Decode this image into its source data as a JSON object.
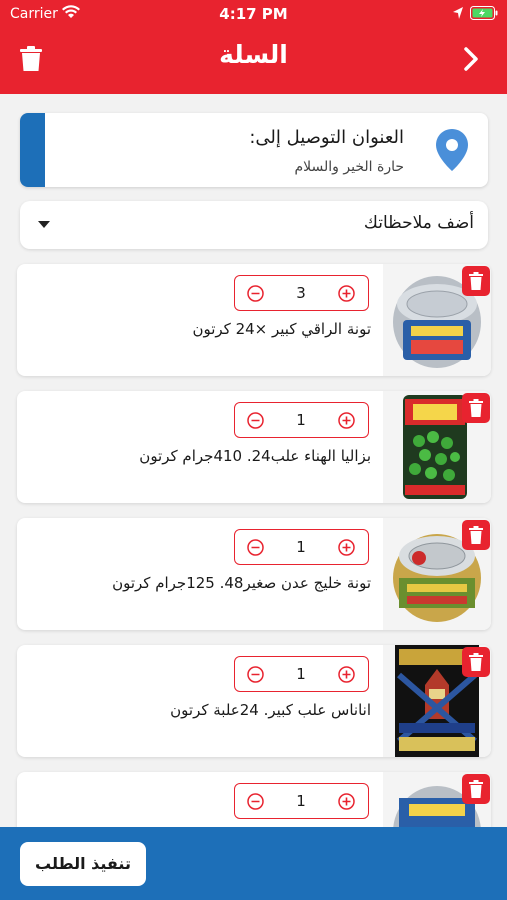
{
  "status_bar": {
    "carrier": "Carrier",
    "time": "4:17 PM"
  },
  "header": {
    "title": "السلة",
    "delete_icon": "trash-icon",
    "back_icon": "chevron-right-icon"
  },
  "address": {
    "title": "العنوان التوصيل إلى:",
    "value": "حارة الخير والسلام",
    "icon": "location-pin-icon"
  },
  "notes": {
    "label": "أضف ملاحظاتك",
    "icon": "caret-down-icon"
  },
  "items": [
    {
      "name": "تونة الراقي كبير ×24 كرتون",
      "quantity": "3"
    },
    {
      "name": "بزاليا الهناء علب24. 410جرام كرتون",
      "quantity": "1"
    },
    {
      "name": "تونة خليج عدن صغير48. 125جرام كرتون",
      "quantity": "1"
    },
    {
      "name": "اناناس علب كبير. 24علبة كرتون",
      "quantity": "1"
    },
    {
      "name": "",
      "quantity": "1"
    }
  ],
  "footer": {
    "submit_label": "تنفيذ الطلب"
  },
  "colors": {
    "primary_red": "#e8232f",
    "primary_blue": "#1d6fb8",
    "background": "#f2f2f2"
  }
}
